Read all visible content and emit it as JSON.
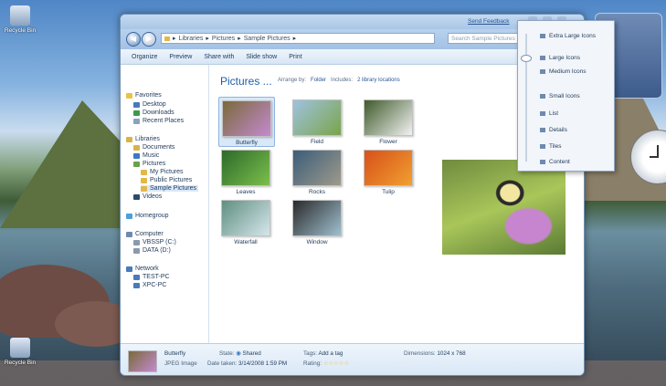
{
  "desktop": {
    "icons": [
      {
        "label": "Recycle Bin"
      },
      {
        "label": "Recycle Bin"
      }
    ]
  },
  "window": {
    "feedback_link": "Send Feedback",
    "address": {
      "crumbs": [
        "Libraries",
        "Pictures",
        "Sample Pictures"
      ]
    },
    "search_placeholder": "Search Sample Pictures",
    "toolbar": [
      "Organize",
      "Preview",
      "Share with",
      "Slide show",
      "Print"
    ],
    "nav": {
      "favorites": {
        "label": "Favorites",
        "items": [
          "Desktop",
          "Downloads",
          "Recent Places"
        ]
      },
      "libraries": {
        "label": "Libraries",
        "items": [
          "Documents",
          "Music",
          "Pictures",
          "My Pictures",
          "Public Pictures",
          "Sample Pictures",
          "Videos"
        ]
      },
      "homegroup": "Homegroup",
      "computer": {
        "label": "Computer",
        "items": [
          "VBSSP (C:)",
          "DATA (D:)"
        ]
      },
      "network": {
        "label": "Network",
        "items": [
          "TEST-PC",
          "XPC-PC"
        ]
      }
    },
    "library": {
      "title": "Pictures ...",
      "arrange_label": "Arrange by:",
      "arrange_value": "Folder",
      "includes_label": "Includes:",
      "includes_value": "2 library locations"
    },
    "thumbnails": [
      {
        "caption": "Butterfly",
        "c1": "#7a6a3a",
        "c2": "#c48ad0"
      },
      {
        "caption": "Field",
        "c1": "#9fc2e0",
        "c2": "#7aa54a"
      },
      {
        "caption": "Flower",
        "c1": "#3f5a2a",
        "c2": "#f2f2f2"
      },
      {
        "caption": "Leaves",
        "c1": "#2c6a2a",
        "c2": "#7cbf4c"
      },
      {
        "caption": "Rocks",
        "c1": "#3a5d7a",
        "c2": "#9f9a8a"
      },
      {
        "caption": "Tulip",
        "c1": "#d8501a",
        "c2": "#f0a030"
      },
      {
        "caption": "Waterfall",
        "c1": "#5f8f7f",
        "c2": "#d6e6ec"
      },
      {
        "caption": "Window",
        "c1": "#2a2a2a",
        "c2": "#9fc0d0"
      }
    ],
    "details": {
      "name": "Butterfly",
      "type": "JPEG Image",
      "state_label": "State:",
      "state_value": "Shared",
      "date_label": "Date taken:",
      "date_value": "3/14/2008 1:59 PM",
      "tags_label": "Tags:",
      "tags_value": "Add a tag",
      "rating_label": "Rating:",
      "rating": 0,
      "dimensions_label": "Dimensions:",
      "dimensions_value": "1024 x 768"
    }
  },
  "view_menu": {
    "items": [
      "Extra Large Icons",
      "Large Icons",
      "Medium Icons",
      "Small Icons",
      "List",
      "Details",
      "Tiles",
      "Content"
    ],
    "selected": "Large Icons"
  },
  "colors": {
    "accent": "#1f5fa8",
    "selection": "#d9e8f9"
  }
}
